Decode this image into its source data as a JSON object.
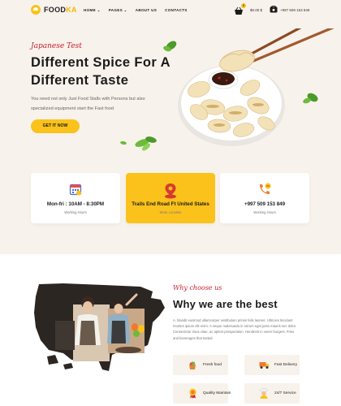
{
  "brand": {
    "part1": "FOOD",
    "part2": "KA"
  },
  "nav": {
    "items": [
      "HOME",
      "PAGES",
      "ABOUT US",
      "CONTACTS"
    ]
  },
  "cart": {
    "count": "2",
    "price": "$0.00 $"
  },
  "phone": "+997 509 153 849",
  "hero": {
    "subtitle": "Japanese Test",
    "title_line1": "Different Spice For A",
    "title_line2": "Different Taste",
    "desc_line1": "You need not only Just Food Stalls with Persons but also",
    "desc_line2": "specialized equipment start the Fast food",
    "button": "GET IT NOW"
  },
  "cards": [
    {
      "title": "Mon-fri : 10AM - 8:30PM",
      "sub": "Working Hours",
      "icon": "calendar-icon"
    },
    {
      "title": "Trails End Road Ft United States",
      "sub": "Store Location",
      "icon": "location-pin-icon"
    },
    {
      "title": "+997 509 153 849",
      "sub": "Working Hours",
      "icon": "phone-24h-icon"
    }
  ],
  "why": {
    "subtitle": "Why choose us",
    "title": "Why we are the best",
    "desc_lines": [
      "A. blandit euismod ullamcorper vestibulum primis felis laoreet. Ultricies tincidunt",
      "montes ipsum elit enim. A neque malesuada in rutrum eget justo mauris nec dolor.",
      "Consectetur risus vitae, ac aptent prosperation. Hendrerit in verier burgers. Fries",
      "and beverages that tasted."
    ],
    "features": [
      {
        "label": "Fresh food",
        "icon": "fresh-food-icon"
      },
      {
        "label": "Fast Delivery",
        "icon": "delivery-truck-icon"
      },
      {
        "label": "Quality Maintain",
        "icon": "quality-badge-icon"
      },
      {
        "label": "24/7 Service",
        "icon": "chef-icon"
      }
    ]
  },
  "colors": {
    "accent": "#fbc21b",
    "red": "#c8202f",
    "hero_bg": "#f8f2ec"
  }
}
